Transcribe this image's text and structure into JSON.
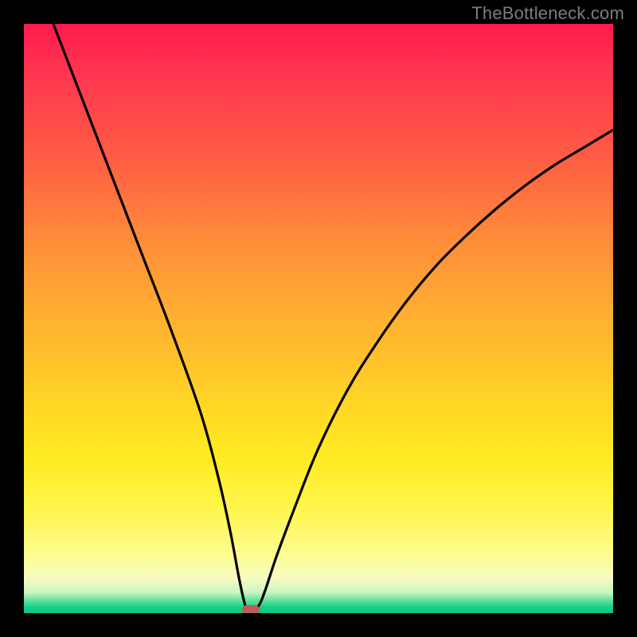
{
  "watermark": "TheBottleneck.com",
  "chart_data": {
    "type": "line",
    "title": "",
    "xlabel": "",
    "ylabel": "",
    "xlim": [
      0,
      100
    ],
    "ylim": [
      0,
      100
    ],
    "grid": false,
    "legend": false,
    "series": [
      {
        "name": "bottleneck-curve",
        "x": [
          5,
          10,
          15,
          20,
          25,
          30,
          33,
          35,
          36.5,
          37.5,
          38,
          39,
          40,
          41,
          43,
          46,
          50,
          55,
          60,
          65,
          70,
          75,
          80,
          85,
          90,
          95,
          100
        ],
        "values": [
          100,
          87,
          74,
          61,
          48,
          34,
          23,
          14,
          6,
          1.5,
          0.5,
          0.5,
          1.5,
          4,
          10,
          18,
          28,
          38,
          46,
          53,
          59,
          64,
          68.5,
          72.5,
          76,
          79,
          82
        ]
      }
    ],
    "annotations": [
      {
        "name": "min-marker",
        "x": 38.5,
        "y": 0.6,
        "color": "#c15a5a"
      }
    ],
    "background_gradient": {
      "top": "#ff1a4d",
      "mid": "#ffe326",
      "bottom": "#08c97e"
    }
  }
}
